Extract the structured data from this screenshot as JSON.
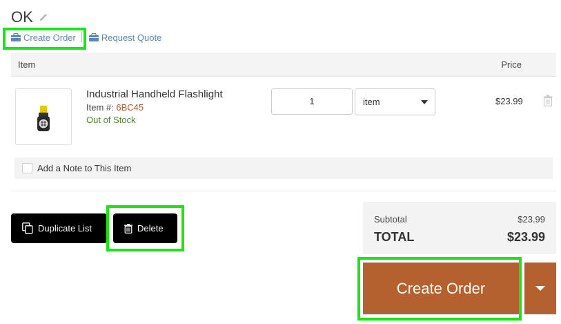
{
  "header": {
    "title": "OK",
    "actions": [
      {
        "label": "Create Order",
        "icon": "briefcase-icon"
      },
      {
        "label": "Request Quote",
        "icon": "briefcase-icon"
      }
    ]
  },
  "table": {
    "columns": [
      "Item",
      "Price"
    ],
    "rows": [
      {
        "name": "Industrial Handheld Flashlight",
        "item_number_label": "Item #:",
        "item_number": "6BC45",
        "stock_status": "Out of Stock",
        "quantity": "1",
        "unit": "item",
        "price": "$23.99"
      }
    ],
    "note_label": "Add a Note to This Item"
  },
  "buttons": {
    "duplicate": "Duplicate List",
    "delete": "Delete"
  },
  "summary": {
    "subtotal_label": "Subtotal",
    "subtotal_value": "$23.99",
    "total_label": "TOTAL",
    "total_value": "$23.99"
  },
  "order": {
    "label": "Create Order"
  },
  "colors": {
    "accent": "#b5602f",
    "link": "#5b86b8",
    "in_stock_text": "#4a8a2a",
    "highlight": "#16e816"
  }
}
